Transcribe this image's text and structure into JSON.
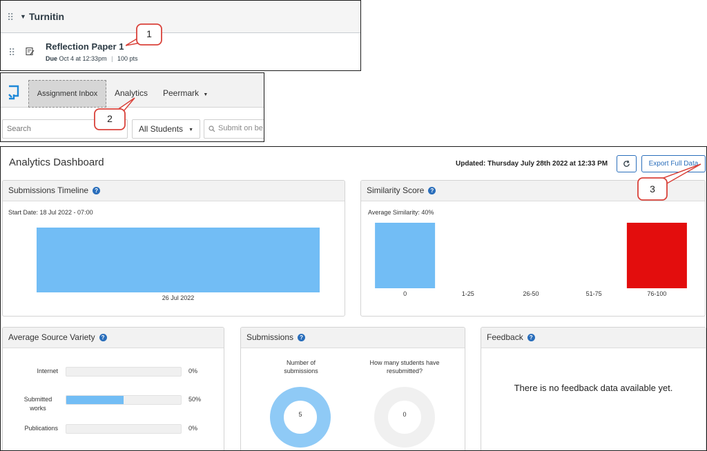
{
  "canvas_module": {
    "title": "Turnitin",
    "item": {
      "title": "Reflection Paper 1",
      "due_label": "Due",
      "due_value": "Oct 4 at 12:33pm",
      "points": "100 pts"
    }
  },
  "turnitin_header": {
    "tabs": {
      "inbox": "Assignment Inbox",
      "analytics": "Analytics",
      "peermark": "Peermark"
    },
    "search": {
      "placeholder": "Search"
    },
    "student_filter": {
      "selected": "All Students"
    },
    "submit_search": {
      "placeholder": "Submit on be"
    }
  },
  "dashboard": {
    "title": "Analytics Dashboard",
    "updated": "Updated: Thursday July 28th 2022 at 12:33 PM",
    "export_label": "Export Full Data",
    "timeline": {
      "title": "Submissions Timeline",
      "start_date": "Start Date: 18 Jul 2022 - 07:00"
    },
    "similarity": {
      "title": "Similarity Score",
      "average": "Average Similarity: 40%"
    },
    "source_variety": {
      "title": "Average Source Variety",
      "rows": [
        {
          "label": "Internet",
          "pct": "0%",
          "value": 0
        },
        {
          "label": "Submitted works",
          "pct": "50%",
          "value": 50
        },
        {
          "label": "Publications",
          "pct": "0%",
          "value": 0
        }
      ]
    },
    "submissions": {
      "title": "Submissions",
      "count_title": "Number of submissions",
      "count_value": "5",
      "resubmit_title": "How many students have resubmitted?",
      "resubmit_value": "0"
    },
    "feedback": {
      "title": "Feedback",
      "empty_message": "There is no feedback data available yet."
    }
  },
  "callouts": [
    "1",
    "2",
    "3"
  ],
  "colors": {
    "bar_blue": "#72bdf5",
    "bar_red": "#e30d0d",
    "link_blue": "#2a6ebb",
    "callout_red": "#d9423a"
  },
  "chart_data": [
    {
      "type": "bar",
      "title": "Submissions Timeline",
      "categories": [
        "26 Jul 2022"
      ],
      "values": [
        5
      ]
    },
    {
      "type": "bar",
      "title": "Similarity Score",
      "categories": [
        "0",
        "1-25",
        "26-50",
        "51-75",
        "76-100"
      ],
      "values": [
        3,
        0,
        0,
        0,
        2
      ]
    }
  ]
}
